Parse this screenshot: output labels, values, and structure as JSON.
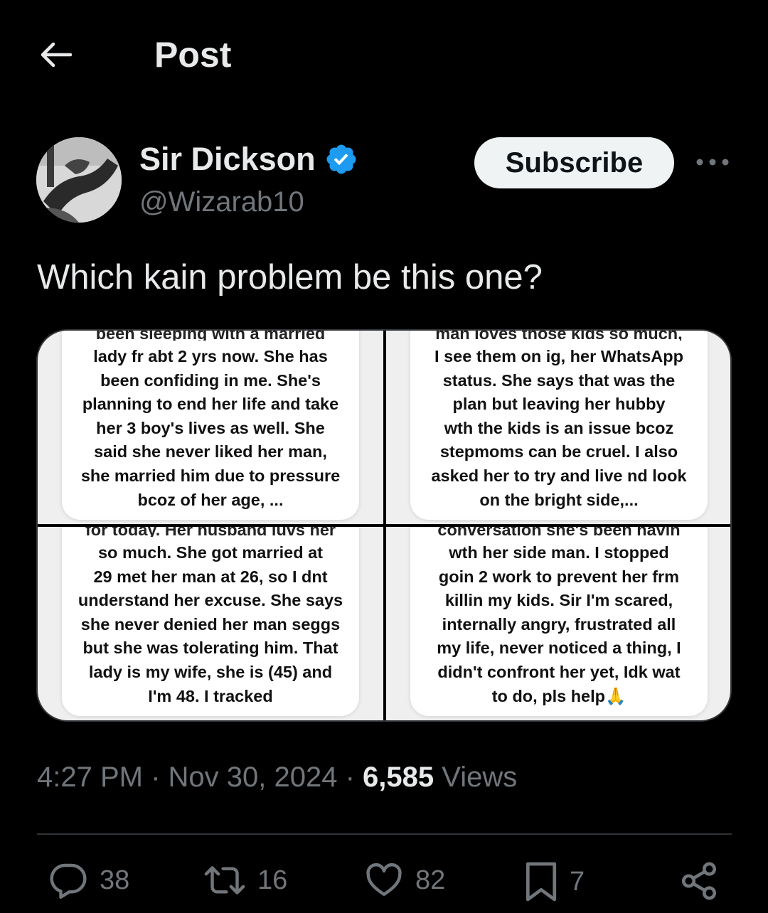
{
  "header": {
    "title": "Post"
  },
  "author": {
    "name": "Sir Dickson",
    "handle": "@Wizarab10",
    "subscribe_label": "Subscribe"
  },
  "post": {
    "text": "Which kain problem be this one?",
    "images": [
      {
        "cut_line": "been sleeping with a married",
        "lines": [
          "lady fr abt 2 yrs now. She has",
          "been confiding in me. She's",
          "planning to end her life and take",
          "her 3 boy's lives as well. She",
          "said she never liked her man,",
          "she married him due to pressure",
          "bcoz of her age, ..."
        ]
      },
      {
        "cut_line": "man loves those kids so much,",
        "lines": [
          "I see them on ig, her WhatsApp",
          "status. She says that was the",
          "plan but leaving her hubby",
          "wth the kids is an issue bcoz",
          "stepmoms can be cruel. I also",
          "asked her to try and live nd look",
          "on the bright side,..."
        ]
      },
      {
        "cut_line": "for today. Her husband luvs her",
        "lines": [
          "so much. She got married at",
          "29 met her man at 26, so I dnt",
          "understand her excuse. She says",
          "she never denied her man seggs",
          "but she was tolerating him. That",
          "lady is my wife, she is (45) and",
          "I'm 48. I tracked"
        ]
      },
      {
        "cut_line": "conversation she's been havin",
        "lines": [
          "wth her side man. I stopped",
          "goin 2 work to prevent her frm",
          "killin my kids. Sir I'm scared,",
          "internally angry, frustrated all",
          "my life, never noticed a thing,  I",
          "didn't confront her yet, Idk wat",
          "to do, pls help🙏"
        ]
      }
    ]
  },
  "meta": {
    "time": "4:27 PM",
    "separator": " · ",
    "date": "Nov 30, 2024",
    "views_count": "6,585",
    "views_label": "Views"
  },
  "actions": {
    "replies": "38",
    "reposts": "16",
    "likes": "82",
    "bookmarks": "7"
  },
  "colors": {
    "background": "#000000",
    "text_primary": "#e7e9ea",
    "text_secondary": "#71767b",
    "verified_badge": "#1d9bf0"
  }
}
